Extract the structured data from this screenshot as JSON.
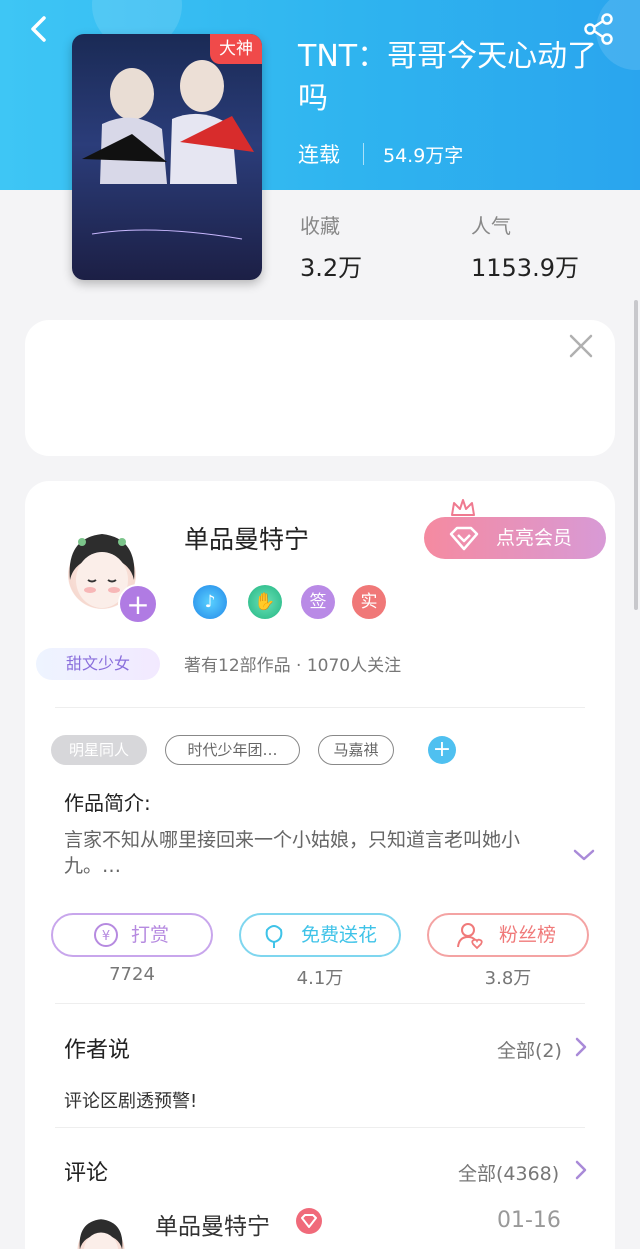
{
  "header": {
    "back_icon": "back-chevron-icon",
    "share_icon": "share-icon",
    "bg_color": "#2fb4ef"
  },
  "book": {
    "title": "TNT：哥哥今天心动了吗",
    "cover_tag": "大神",
    "status": "连载",
    "word_count": "54.9万字",
    "favorites_label": "收藏",
    "favorites_value": "3.2万",
    "popularity_label": "人气",
    "popularity_value": "1153.9万"
  },
  "ad": {
    "close_icon": "close-icon"
  },
  "author": {
    "name": "单品曼特宁",
    "tag": "甜文少女",
    "vip_button": "点亮会员",
    "badges": [
      {
        "icon": "music-medal-icon",
        "color": "#3a9bf0",
        "label": ""
      },
      {
        "icon": "handshake-medal-icon",
        "color": "#2cc59a",
        "label": ""
      },
      {
        "icon": "signed-badge",
        "color": "#b98ae6",
        "label": "签"
      },
      {
        "icon": "verified-badge",
        "color": "#f07878",
        "label": "实"
      }
    ],
    "meta": "著有12部作品 · 1070人关注"
  },
  "tags": [
    "明星同人",
    "时代少年团…",
    "马嘉祺"
  ],
  "intro": {
    "title": "作品简介:",
    "text": "言家不知从哪里接回来一个小姑娘，只知道言老叫她小九。…"
  },
  "actions": [
    {
      "label": "打赏",
      "count": "7724",
      "icon": "yen-coin-icon",
      "color": "#b68ae0"
    },
    {
      "label": "免费送花",
      "count": "4.1万",
      "icon": "flower-icon",
      "color": "#3fc3e8"
    },
    {
      "label": "粉丝榜",
      "count": "3.8万",
      "icon": "fan-rank-icon",
      "color": "#f07a7a"
    }
  ],
  "author_says": {
    "title": "作者说",
    "more": "全部(2)",
    "text": "评论区剧透预警!"
  },
  "comments": {
    "title": "评论",
    "more": "全部(4368)",
    "first": {
      "name": "单品曼特宁",
      "date": "01-16"
    }
  }
}
